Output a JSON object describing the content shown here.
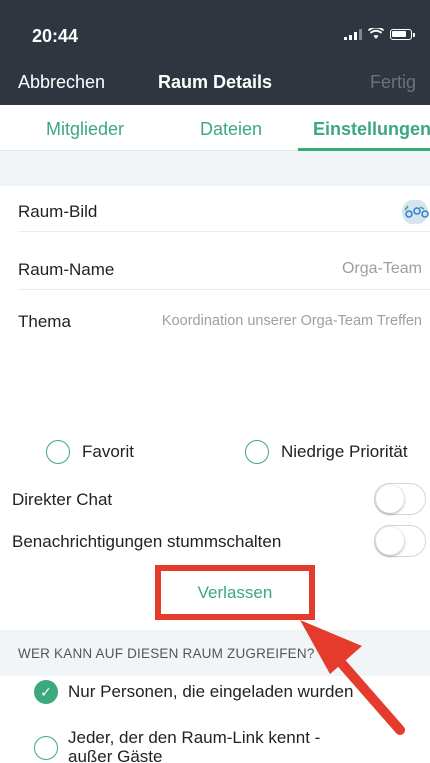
{
  "status": {
    "time": "20:44"
  },
  "nav": {
    "cancel": "Abbrechen",
    "title": "Raum Details",
    "done": "Fertig"
  },
  "tabs": [
    {
      "label": "Mitglieder"
    },
    {
      "label": "Dateien"
    },
    {
      "label": "Einstellungen",
      "active": true
    }
  ],
  "settings": {
    "room_image_label": "Raum-Bild",
    "room_name_label": "Raum-Name",
    "room_name_value": "Orga-Team",
    "topic_label": "Thema",
    "topic_value": "Koordination unserer Orga-Team Treffen"
  },
  "tags": {
    "favorite": "Favorit",
    "low_priority": "Niedrige Priorität"
  },
  "toggles": {
    "direct_chat": "Direkter Chat",
    "mute": "Benachrichtigungen stummschalten"
  },
  "leave_button": "Verlassen",
  "access": {
    "title": "WER KANN AUF DIESEN RAUM ZUGREIFEN?",
    "option_invited": "Nur Personen, die eingeladen wurden",
    "option_link_line1": "Jeder, der den Raum-Link kennt -",
    "option_link_line2": "außer Gäste"
  },
  "colors": {
    "accent": "#3ca87e",
    "header": "#2f3640",
    "highlight": "#e53b2c"
  }
}
